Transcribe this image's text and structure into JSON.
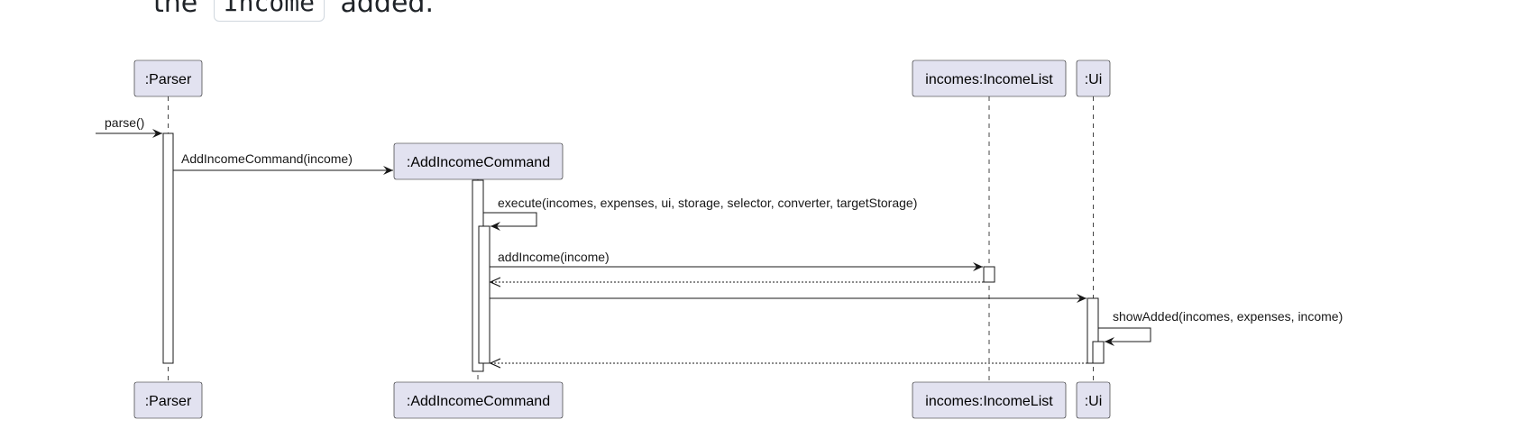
{
  "doc_text": {
    "prefix": "the",
    "code": "Income",
    "suffix": "added."
  },
  "colors": {
    "participant_fill": "#e2e2f0",
    "participant_border": "#181818",
    "lifeline": "#181818",
    "activation_fill": "#ffffff",
    "arrow": "#181818",
    "page_background": "#ffffff"
  },
  "diagram": {
    "participants": [
      {
        "id": "parser",
        "label": ":Parser"
      },
      {
        "id": "cmd",
        "label": ":AddIncomeCommand"
      },
      {
        "id": "incomes",
        "label": "incomes:IncomeList"
      },
      {
        "id": "ui",
        "label": ":Ui"
      }
    ],
    "messages": [
      {
        "id": "parse",
        "label": "parse()",
        "kind": "found-sync"
      },
      {
        "id": "create-cmd",
        "label": "AddIncomeCommand(income)",
        "kind": "create"
      },
      {
        "id": "execute",
        "label": "execute(incomes, expenses, ui, storage, selector, converter, targetStorage)",
        "kind": "self-sync"
      },
      {
        "id": "add-income",
        "label": "addIncome(income)",
        "kind": "sync"
      },
      {
        "id": "add-income-return",
        "label": "",
        "kind": "return"
      },
      {
        "id": "to-ui",
        "label": "",
        "kind": "sync"
      },
      {
        "id": "show-added",
        "label": "showAdded(incomes, expenses, income)",
        "kind": "self-sync"
      },
      {
        "id": "ui-return",
        "label": "",
        "kind": "return"
      }
    ]
  }
}
